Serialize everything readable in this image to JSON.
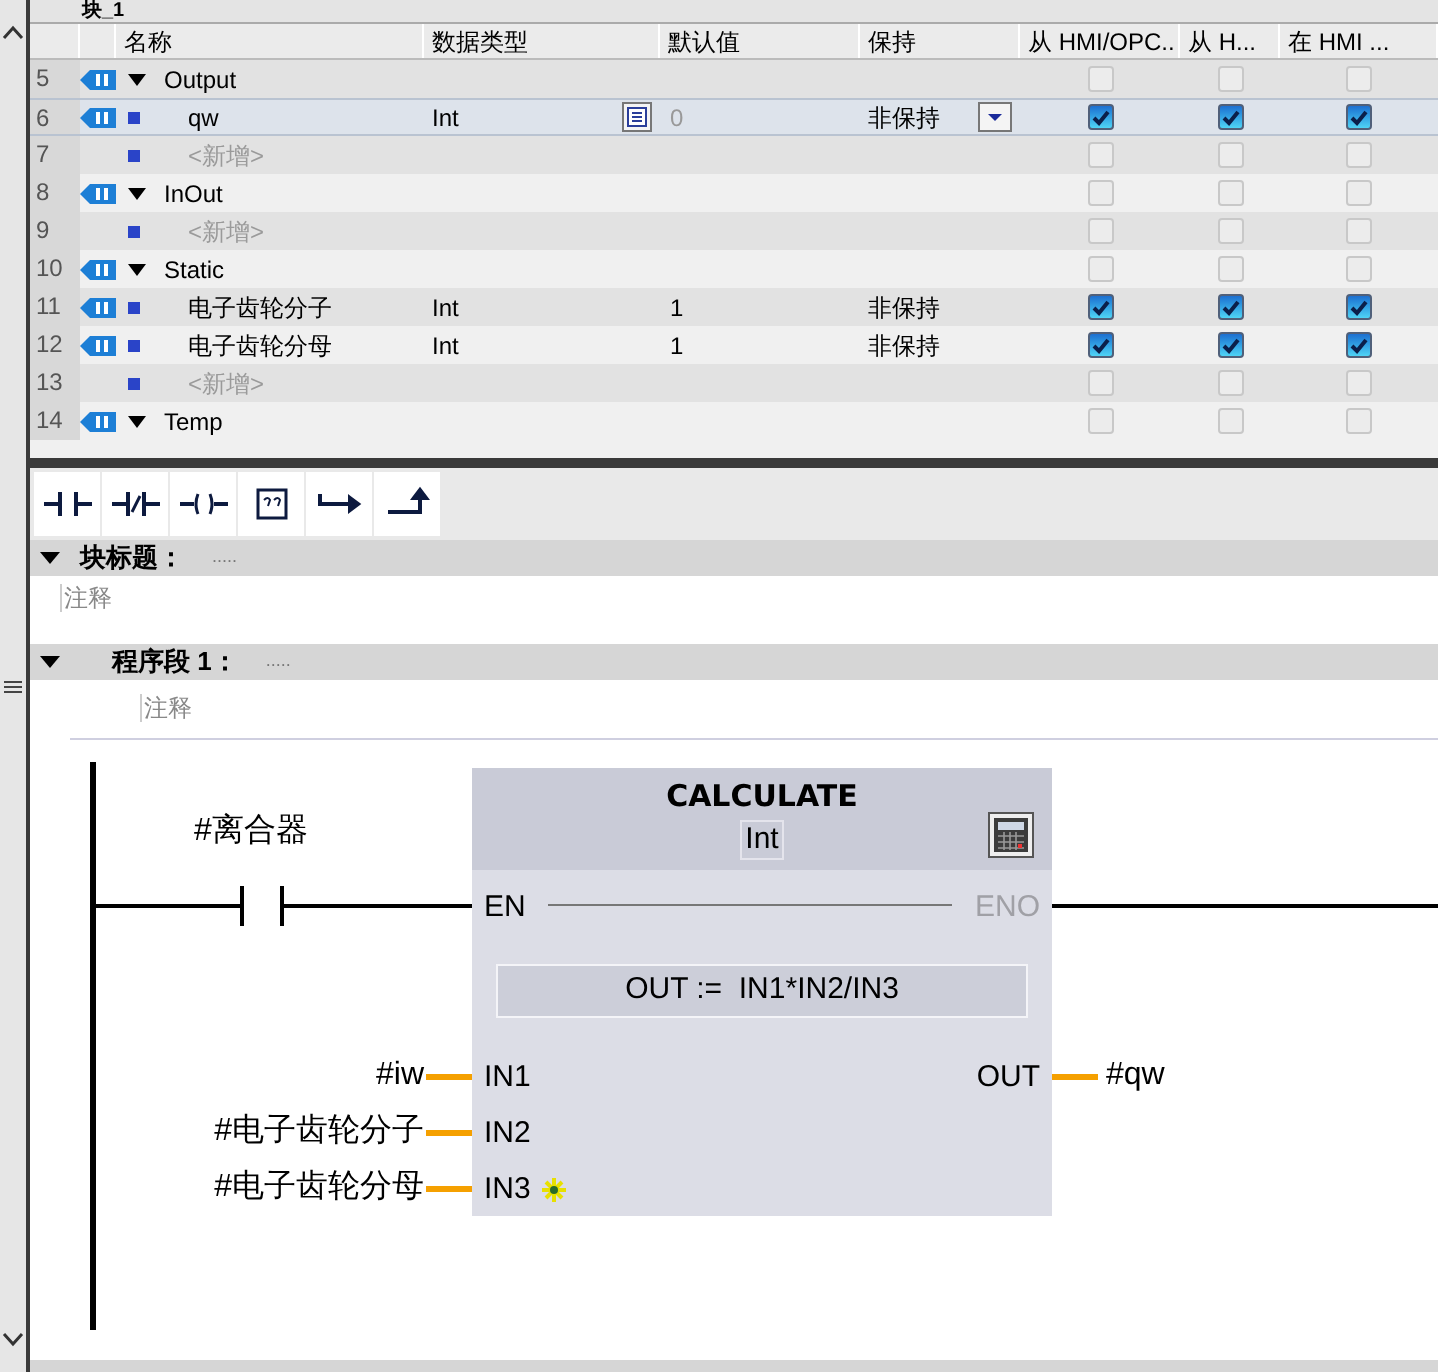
{
  "editor_title": "块_1",
  "table": {
    "columns": [
      "名称",
      "数据类型",
      "默认值",
      "保持",
      "从 HMI/OPC..",
      "从 H...",
      "在 HMI ..."
    ],
    "rows": [
      {
        "number": "5",
        "kind": "section",
        "name": "Output",
        "expanded": true,
        "selected": false,
        "hmi": [
          {
            "checked": false
          },
          {
            "checked": false
          },
          {
            "checked": false
          }
        ]
      },
      {
        "number": "6",
        "kind": "variable",
        "name": "qw",
        "data_type": "Int",
        "default": "0",
        "retain": "非保持",
        "selected": true,
        "hmi": [
          {
            "checked": true
          },
          {
            "checked": true
          },
          {
            "checked": true
          }
        ]
      },
      {
        "number": "7",
        "kind": "add",
        "name": "<新增>",
        "selected": false,
        "hmi": [
          {
            "checked": false
          },
          {
            "checked": false
          },
          {
            "checked": false
          }
        ]
      },
      {
        "number": "8",
        "kind": "section",
        "name": "InOut",
        "expanded": true,
        "selected": false,
        "hmi": [
          {
            "checked": false
          },
          {
            "checked": false
          },
          {
            "checked": false
          }
        ]
      },
      {
        "number": "9",
        "kind": "add",
        "name": "<新增>",
        "selected": false,
        "hmi": [
          {
            "checked": false
          },
          {
            "checked": false
          },
          {
            "checked": false
          }
        ]
      },
      {
        "number": "10",
        "kind": "section",
        "name": "Static",
        "expanded": true,
        "selected": false,
        "hmi": [
          {
            "checked": false
          },
          {
            "checked": false
          },
          {
            "checked": false
          }
        ]
      },
      {
        "number": "11",
        "kind": "variable",
        "name": "电子齿轮分子",
        "data_type": "Int",
        "default": "1",
        "retain": "非保持",
        "selected": false,
        "hmi": [
          {
            "checked": true
          },
          {
            "checked": true
          },
          {
            "checked": true
          }
        ]
      },
      {
        "number": "12",
        "kind": "variable",
        "name": "电子齿轮分母",
        "data_type": "Int",
        "default": "1",
        "retain": "非保持",
        "selected": false,
        "hmi": [
          {
            "checked": true
          },
          {
            "checked": true
          },
          {
            "checked": true
          }
        ]
      },
      {
        "number": "13",
        "kind": "add",
        "name": "<新增>",
        "selected": false,
        "hmi": [
          {
            "checked": false
          },
          {
            "checked": false
          },
          {
            "checked": false
          }
        ]
      },
      {
        "number": "14",
        "kind": "section",
        "name": "Temp",
        "expanded": true,
        "selected": false,
        "hmi": [
          {
            "checked": false
          },
          {
            "checked": false
          },
          {
            "checked": false
          }
        ]
      }
    ]
  },
  "toolbar": [
    {
      "kind": "no_contact"
    },
    {
      "kind": "nc_contact"
    },
    {
      "kind": "coil"
    },
    {
      "kind": "empty_box"
    },
    {
      "kind": "open_branch"
    },
    {
      "kind": "close_branch"
    }
  ],
  "block_title": {
    "label": "块标题：",
    "dots": ".....",
    "comment": "注释",
    "expanded": true
  },
  "network": {
    "label": "程序段 1：",
    "dots": ".....",
    "comment": "注释",
    "expanded": true
  },
  "ladder": {
    "contact": {
      "operand": "#离合器"
    },
    "box": {
      "name": "CALCULATE",
      "type": "Int",
      "en": "EN",
      "eno": "ENO",
      "eno_connected": false,
      "formula": "OUT :=  IN1*IN2/IN3",
      "inputs": [
        {
          "pin": "IN1",
          "operand": "#iw"
        },
        {
          "pin": "IN2",
          "operand": "#电子齿轮分子"
        },
        {
          "pin": "IN3",
          "operand": "#电子齿轮分母",
          "add_marker": true
        }
      ],
      "outputs": [
        {
          "pin": "OUT",
          "operand": "#qw"
        }
      ]
    }
  }
}
